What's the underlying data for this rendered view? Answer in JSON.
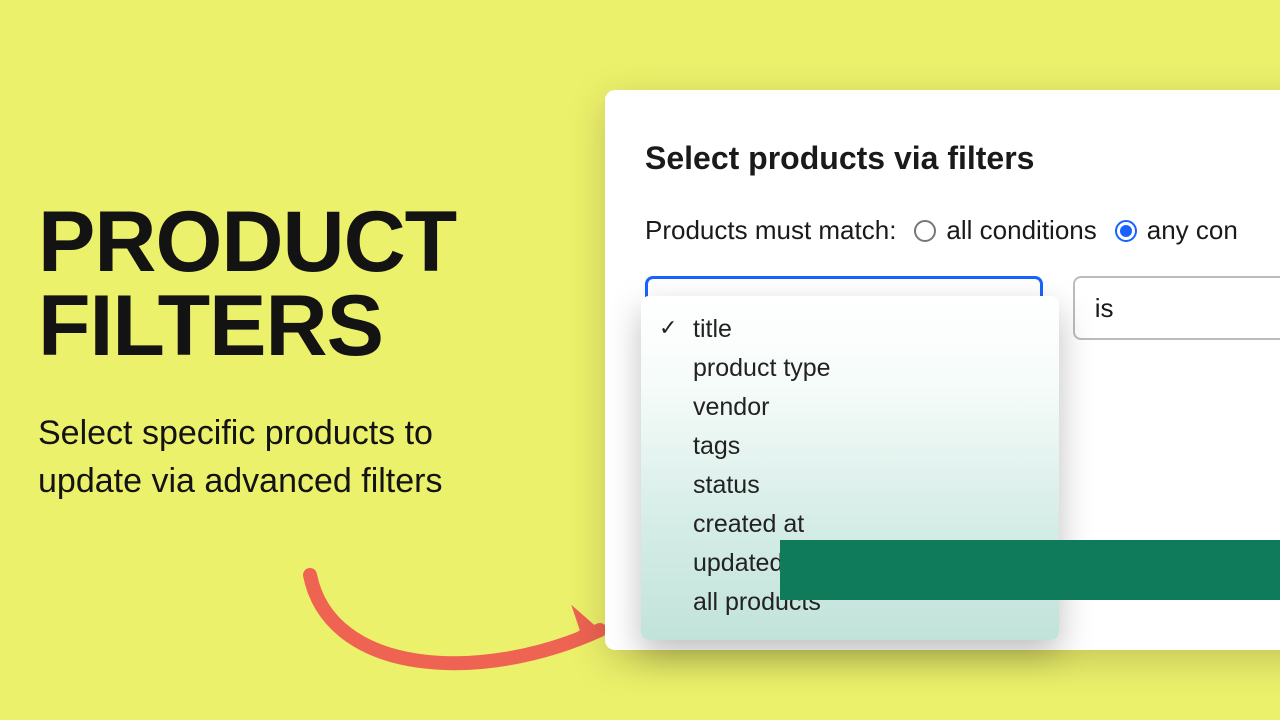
{
  "hero": {
    "headline_line1": "PRODUCT",
    "headline_line2": "FILTERS",
    "subhead": "Select specific products to update via advanced filters"
  },
  "panel": {
    "title": "Select products via filters",
    "match_label": "Products must match:",
    "radios": {
      "all_label": "all conditions",
      "any_label": "any con"
    },
    "condition_value": "is",
    "dropdown": {
      "selected_index": 0,
      "options": [
        "title",
        "product type",
        "vendor",
        "tags",
        "status",
        "created at",
        "updated at",
        "all products"
      ]
    }
  }
}
